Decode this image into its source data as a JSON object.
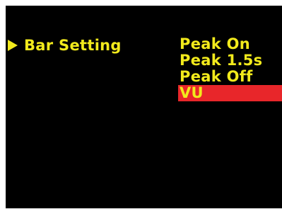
{
  "colors": {
    "text": "#f2ea1c",
    "background": "#000000",
    "highlight": "#e8262a"
  },
  "menu": {
    "indicator_icon": "triangle-right-icon",
    "heading": "Bar Setting",
    "options": [
      {
        "label": "Peak On",
        "selected": false
      },
      {
        "label": "Peak 1.5s",
        "selected": false
      },
      {
        "label": "Peak Off",
        "selected": false
      },
      {
        "label": "VU",
        "selected": true
      }
    ]
  }
}
